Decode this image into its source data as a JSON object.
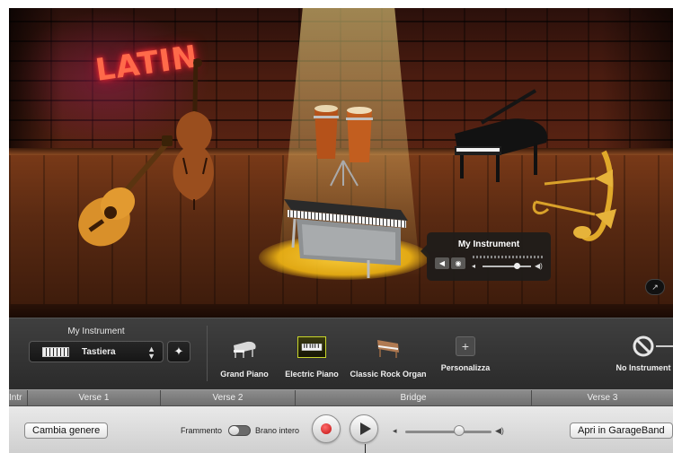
{
  "stage": {
    "genre_sign": "LATIN",
    "instruments": {
      "guitar": "guitar-icon",
      "double_bass": "double-bass-icon",
      "congas": "congas-icon",
      "grand_piano": "grand-piano-icon",
      "brass": "brass-icon",
      "electric_piano": "electric-piano-icon"
    },
    "mixer_popover": {
      "title": "My Instrument",
      "mute_icon": "speaker-mute-icon",
      "solo_icon": "headphones-icon",
      "volume_level": 0.7
    },
    "fullscreen_icon": "expand-icon"
  },
  "instrument_bar": {
    "current_label": "My Instrument",
    "preset_value": "Tastiera",
    "settings_icon": "wrench-icon",
    "tiles": [
      {
        "label": "Grand Piano",
        "icon": "grand-piano-icon",
        "selected": false
      },
      {
        "label": "Electric Piano",
        "icon": "electric-piano-icon",
        "selected": true
      },
      {
        "label": "Classic Rock Organ",
        "icon": "organ-icon",
        "selected": false
      },
      {
        "label": "Personalizza",
        "icon": "plus-icon",
        "selected": false
      }
    ],
    "no_instrument_label": "No Instrument"
  },
  "sections": [
    "Intr",
    "Verse 1",
    "Verse 2",
    "Bridge",
    "Verse 3"
  ],
  "controls": {
    "change_genre": "Cambia genere",
    "fragment_label": "Frammento",
    "full_song_label": "Brano intero",
    "open_garageband": "Apri in GarageBand",
    "master_volume": 0.62
  },
  "colors": {
    "record": "#c01010",
    "selected_tile_border": "#c9d62a",
    "spotlight": "#fbc21a",
    "genre_sign": "#ff6a4a"
  }
}
